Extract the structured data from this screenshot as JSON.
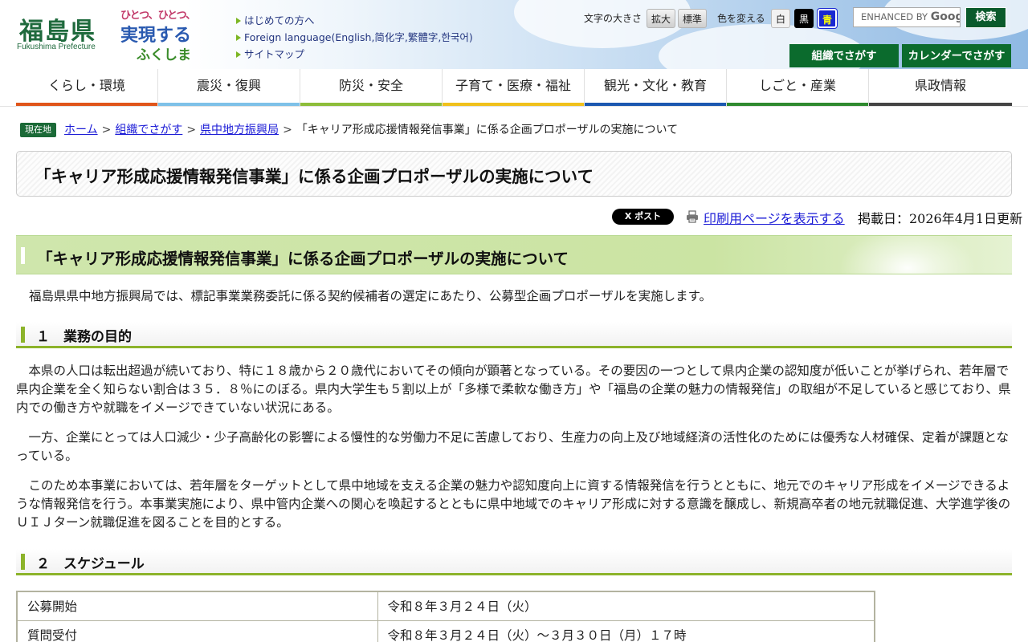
{
  "header": {
    "logo_jp": "福島県",
    "logo_en": "Fukushima Prefecture",
    "slogan": [
      "ひとつ、ひとつ、",
      "実現する",
      "ふくしま"
    ],
    "quick_links": [
      "はじめての方へ",
      "Foreign language(English,简化字,繁體字,한국어)",
      "サイトマップ"
    ],
    "font_size_label": "文字の大きさ",
    "font_enlarge": "拡大",
    "font_standard": "標準",
    "color_label": "色を変える",
    "color_white": "白",
    "color_black": "黒",
    "color_blue": "青",
    "search_placeholder_prefix": "ENHANCED BY",
    "search_placeholder_brand": "Google",
    "search_button": "検索",
    "org_button": "組織でさがす",
    "calendar_button": "カレンダーでさがす"
  },
  "nav": {
    "items": [
      {
        "label": "くらし・環境",
        "color": "#e0551a"
      },
      {
        "label": "震災・復興",
        "color": "#7ec1e8"
      },
      {
        "label": "防災・安全",
        "color": "#8dbd3a"
      },
      {
        "label": "子育て・医療・福祉",
        "color": "#f0c11c"
      },
      {
        "label": "観光・文化・教育",
        "color": "#1c58b0"
      },
      {
        "label": "しごと・産業",
        "color": "#2f8a2f"
      },
      {
        "label": "県政情報",
        "color": "#444444"
      }
    ]
  },
  "breadcrumb": {
    "here": "現在地",
    "links": [
      "ホーム",
      "組織でさがす",
      "県中地方振興局"
    ],
    "current": "「キャリア形成応援情報発信事業」に係る企画プロポーザルの実施について"
  },
  "page": {
    "title": "「キャリア形成応援情報発信事業」に係る企画プロポーザルの実施について",
    "x_post": "X ポスト",
    "print_link": "印刷用ページを表示する",
    "updated": "掲載日：2026年4月1日更新",
    "h2": "「キャリア形成応援情報発信事業」に係る企画プロポーザルの実施について",
    "intro": "福島県県中地方振興局では、標記事業業務委託に係る契約候補者の選定にあたり、公募型企画プロポーザルを実施します。",
    "section1": {
      "heading": "１　業務の目的",
      "paragraphs": [
        "本県の人口は転出超過が続いており、特に１８歳から２０歳代においてその傾向が顕著となっている。その要因の一つとして県内企業の認知度が低いことが挙げられ、若年層で県内企業を全く知らない割合は３５．８％にのぼる。県内大学生も５割以上が「多様で柔軟な働き方」や「福島の企業の魅力の情報発信」の取組が不足していると感じており、県内での働き方や就職をイメージできていない状況にある。",
        "一方、企業にとっては人口減少・少子高齢化の影響による慢性的な労働力不足に苦慮しており、生産力の向上及び地域経済の活性化のためには優秀な人材確保、定着が課題となっている。",
        "このため本事業においては、若年層をターゲットとして県中地域を支える企業の魅力や認知度向上に資する情報発信を行うとともに、地元でのキャリア形成をイメージできるような情報発信を行う。本事業実施により、県中管内企業への関心を喚起するとともに県中地域でのキャリア形成に対する意識を醸成し、新規高卒者の地元就職促進、大学進学後のＵＩＪターン就職促進を図ることを目的とする。"
      ]
    },
    "section2": {
      "heading": "２　スケジュール",
      "rows": [
        {
          "label": "公募開始",
          "value": "令和８年３月２４日（火）"
        },
        {
          "label": "質問受付",
          "value": "令和８年３月２４日（火）～３月３０日（月）１７時"
        }
      ]
    }
  }
}
